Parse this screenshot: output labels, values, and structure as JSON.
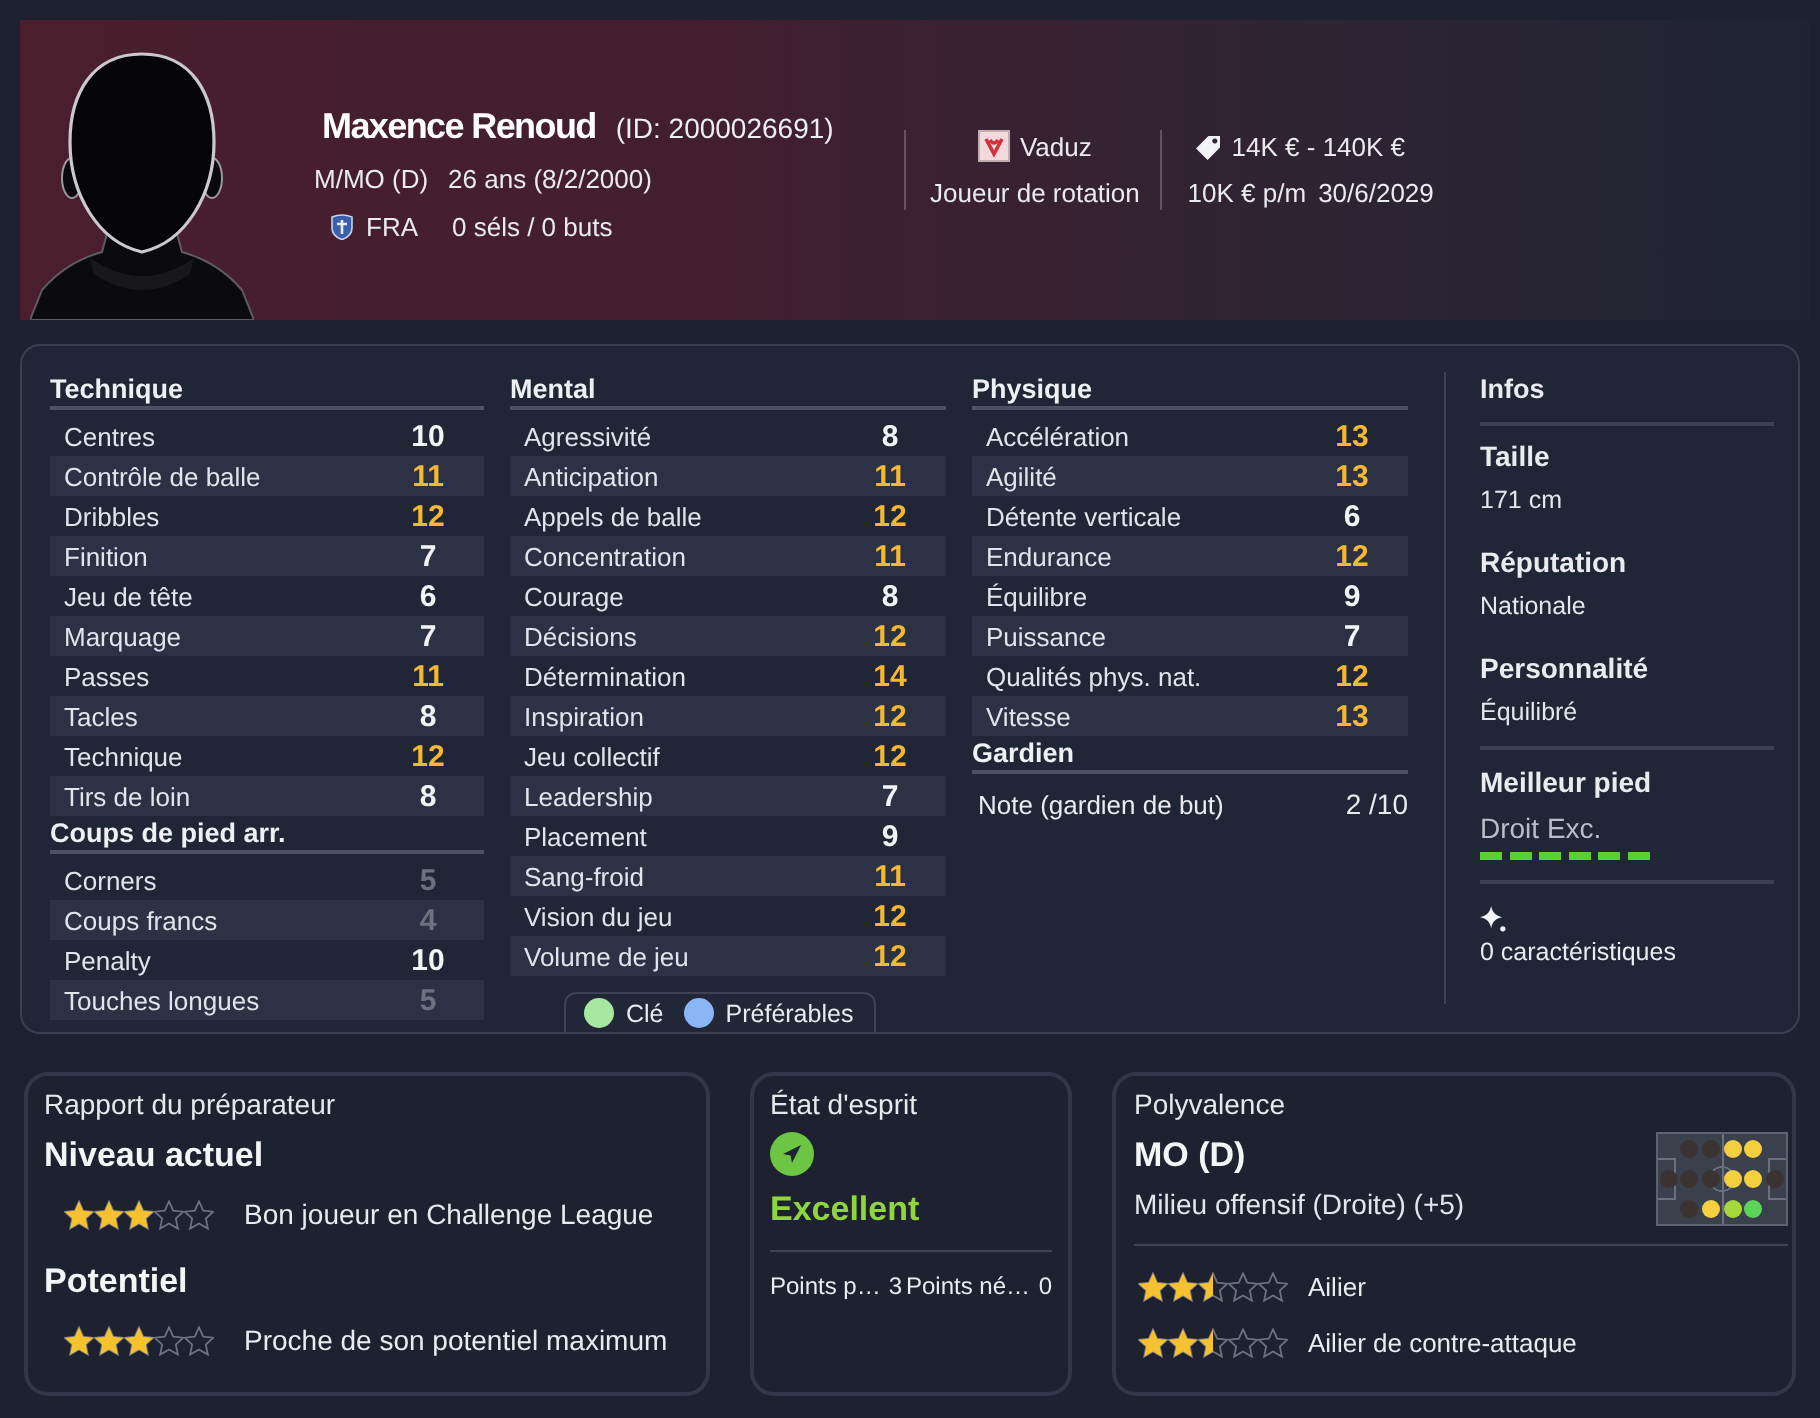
{
  "header": {
    "name": "Maxence Renoud",
    "id": "(ID: 2000026691)",
    "position": "M/MO (D)",
    "age": "26 ans (8/2/2000)",
    "nationality": "FRA",
    "caps": "0 séls / 0 buts",
    "club": "Vaduz",
    "squad_status": "Joueur de rotation",
    "value": "14K € - 140K €",
    "wage": "10K € p/m",
    "contract_end": "30/6/2029"
  },
  "attributes": {
    "columns": [
      {
        "sections": [
          {
            "title": "Technique",
            "rows": [
              {
                "name": "Centres",
                "value": "10",
                "color": "#f2f3f5"
              },
              {
                "name": "Contrôle de balle",
                "value": "11",
                "color": "#f6b833"
              },
              {
                "name": "Dribbles",
                "value": "12",
                "color": "#f6b833"
              },
              {
                "name": "Finition",
                "value": "7",
                "color": "#f2f3f5"
              },
              {
                "name": "Jeu de tête",
                "value": "6",
                "color": "#f2f3f5"
              },
              {
                "name": "Marquage",
                "value": "7",
                "color": "#f2f3f5"
              },
              {
                "name": "Passes",
                "value": "11",
                "color": "#f6b833"
              },
              {
                "name": "Tacles",
                "value": "8",
                "color": "#f2f3f5"
              },
              {
                "name": "Technique",
                "value": "12",
                "color": "#f6b833"
              },
              {
                "name": "Tirs de loin",
                "value": "8",
                "color": "#f2f3f5"
              }
            ]
          },
          {
            "title": "Coups de pied arr.",
            "rows": [
              {
                "name": "Corners",
                "value": "5",
                "color": "#6c717e"
              },
              {
                "name": "Coups francs",
                "value": "4",
                "color": "#6c717e"
              },
              {
                "name": "Penalty",
                "value": "10",
                "color": "#f2f3f5"
              },
              {
                "name": "Touches longues",
                "value": "5",
                "color": "#6c717e"
              }
            ]
          }
        ]
      },
      {
        "sections": [
          {
            "title": "Mental",
            "rows": [
              {
                "name": "Agressivité",
                "value": "8",
                "color": "#f2f3f5"
              },
              {
                "name": "Anticipation",
                "value": "11",
                "color": "#f6b833"
              },
              {
                "name": "Appels de balle",
                "value": "12",
                "color": "#f6b833"
              },
              {
                "name": "Concentration",
                "value": "11",
                "color": "#f6b833"
              },
              {
                "name": "Courage",
                "value": "8",
                "color": "#f2f3f5"
              },
              {
                "name": "Décisions",
                "value": "12",
                "color": "#f6b833"
              },
              {
                "name": "Détermination",
                "value": "14",
                "color": "#f6b833"
              },
              {
                "name": "Inspiration",
                "value": "12",
                "color": "#f6b833"
              },
              {
                "name": "Jeu collectif",
                "value": "12",
                "color": "#f6b833"
              },
              {
                "name": "Leadership",
                "value": "7",
                "color": "#f2f3f5"
              },
              {
                "name": "Placement",
                "value": "9",
                "color": "#f2f3f5"
              },
              {
                "name": "Sang-froid",
                "value": "11",
                "color": "#f6b833"
              },
              {
                "name": "Vision du jeu",
                "value": "12",
                "color": "#f6b833"
              },
              {
                "name": "Volume de jeu",
                "value": "12",
                "color": "#f6b833"
              }
            ]
          }
        ],
        "legend": [
          {
            "label": "Clé",
            "color": "#a6e8a0"
          },
          {
            "label": "Préférables",
            "color": "#8ab6f5"
          }
        ]
      },
      {
        "sections": [
          {
            "title": "Physique",
            "rows": [
              {
                "name": "Accélération",
                "value": "13",
                "color": "#f6b833"
              },
              {
                "name": "Agilité",
                "value": "13",
                "color": "#f6b833"
              },
              {
                "name": "Détente verticale",
                "value": "6",
                "color": "#f2f3f5"
              },
              {
                "name": "Endurance",
                "value": "12",
                "color": "#f6b833"
              },
              {
                "name": "Équilibre",
                "value": "9",
                "color": "#f2f3f5"
              },
              {
                "name": "Puissance",
                "value": "7",
                "color": "#f2f3f5"
              },
              {
                "name": "Qualités phys. nat.",
                "value": "12",
                "color": "#f6b833"
              },
              {
                "name": "Vitesse",
                "value": "13",
                "color": "#f6b833"
              }
            ]
          },
          {
            "title": "Gardien",
            "rating": {
              "label": "Note (gardien de but)",
              "value": "2 /10"
            }
          }
        ]
      }
    ]
  },
  "infos": {
    "title": "Infos",
    "items": [
      {
        "label": "Taille",
        "value": "171 cm"
      },
      {
        "label": "Réputation",
        "value": "Nationale"
      },
      {
        "label": "Personnalité",
        "value": "Équilibré"
      }
    ],
    "best_foot": {
      "label": "Meilleur pied",
      "value": "Droit Exc.",
      "level": 1
    },
    "traits": "0 caractéristiques"
  },
  "coach_report": {
    "title": "Rapport du préparateur",
    "ratings": [
      {
        "heading": "Niveau actuel",
        "stars": 3,
        "text": "Bon joueur en Challenge League"
      },
      {
        "heading": "Potentiel",
        "stars": 3,
        "text": "Proche de son potentiel maximum"
      }
    ]
  },
  "mindset": {
    "title": "État d'esprit",
    "status": "Excellent",
    "points": [
      {
        "label": "Points p…",
        "value": "3"
      },
      {
        "label": "Points né…",
        "value": "0"
      }
    ]
  },
  "versatility": {
    "title": "Polyvalence",
    "position": "MO (D)",
    "description": "Milieu offensif (Droite) (+5)",
    "pitch": {
      "rows": [
        {
          "dots": [
            {
              "kind": "gap"
            },
            {
              "kind": "dot",
              "color": "#3b3232"
            },
            {
              "kind": "dot",
              "color": "#3b3232"
            },
            {
              "kind": "dot",
              "color": "#f4d03f"
            },
            {
              "kind": "dot",
              "color": "#f4d03f"
            },
            {
              "kind": "gap"
            }
          ]
        },
        {
          "dots": [
            {
              "kind": "dot",
              "color": "#3b3232"
            },
            {
              "kind": "dot",
              "color": "#3b3232"
            },
            {
              "kind": "dot",
              "color": "#3b3232"
            },
            {
              "kind": "dot",
              "color": "#f4d03f"
            },
            {
              "kind": "dot",
              "color": "#f4d03f"
            },
            {
              "kind": "dot",
              "color": "#3b3232"
            }
          ]
        },
        {
          "dots": [
            {
              "kind": "gap"
            },
            {
              "kind": "dot",
              "color": "#3b3232"
            },
            {
              "kind": "dot",
              "color": "#f4d03f"
            },
            {
              "kind": "dot",
              "color": "#a6d83c"
            },
            {
              "kind": "dot",
              "color": "#5ed35a"
            },
            {
              "kind": "gap"
            }
          ]
        }
      ]
    },
    "roles": [
      {
        "name": "Ailier",
        "stars": 2.5
      },
      {
        "name": "Ailier de contre-attaque",
        "stars": 2.5
      }
    ]
  }
}
